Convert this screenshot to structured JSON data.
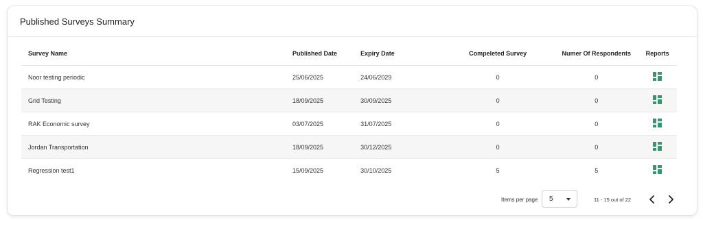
{
  "card": {
    "title": "Published Surveys Summary"
  },
  "table": {
    "headers": {
      "name": "Survey Name",
      "published": "Published Date",
      "expiry": "Expiry Date",
      "completed": "Compeleted Survey",
      "respondents": "Numer Of Respondents",
      "reports": "Reports"
    },
    "rows": [
      {
        "name": "Noor testing periodic",
        "published": "25/06/2025",
        "expiry": "24/06/2029",
        "completed": "0",
        "respondents": "0"
      },
      {
        "name": "Grid Testing",
        "published": "18/09/2025",
        "expiry": "30/09/2025",
        "completed": "0",
        "respondents": "0"
      },
      {
        "name": "RAK Economic survey",
        "published": "03/07/2025",
        "expiry": "31/07/2025",
        "completed": "0",
        "respondents": "0"
      },
      {
        "name": "Jordan Transportation",
        "published": "18/09/2025",
        "expiry": "30/12/2025",
        "completed": "0",
        "respondents": "0"
      },
      {
        "name": "Regression test1",
        "published": "15/09/2025",
        "expiry": "30/10/2025",
        "completed": "5",
        "respondents": "5"
      }
    ],
    "report_icon": "dashboard-grid-icon",
    "report_icon_color": "#2e9a6e"
  },
  "pagination": {
    "items_per_page_label": "Items per page",
    "items_per_page_value": "5",
    "range_text": "11 - 15 out of 22",
    "prev_icon": "chevron-left-icon",
    "next_icon": "chevron-right-icon"
  }
}
